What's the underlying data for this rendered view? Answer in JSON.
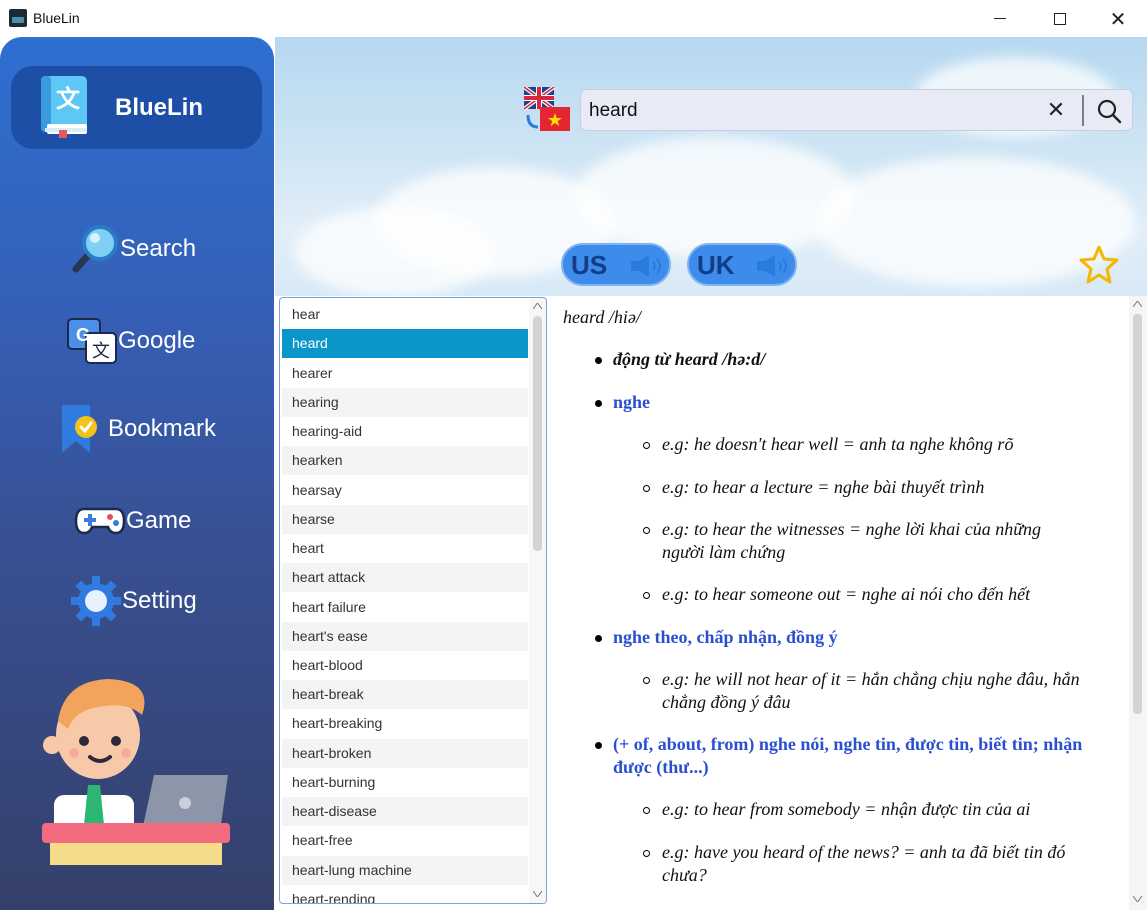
{
  "window": {
    "title": "BlueLin"
  },
  "sidebar": {
    "app_name": "BlueLin",
    "items": [
      {
        "label": "Search",
        "icon": "magnifier-icon"
      },
      {
        "label": "Google",
        "icon": "google-translate-icon"
      },
      {
        "label": "Bookmark",
        "icon": "bookmark-icon"
      },
      {
        "label": "Game",
        "icon": "gamepad-icon"
      },
      {
        "label": "Setting",
        "icon": "gear-icon"
      }
    ]
  },
  "search": {
    "value": "heard",
    "lang_pair": "en-vi"
  },
  "pronunciation": {
    "us_label": "US",
    "uk_label": "UK"
  },
  "wordlist": {
    "selected": "heard",
    "items": [
      "hear",
      "heard",
      "hearer",
      "hearing",
      "hearing-aid",
      "hearken",
      "hearsay",
      "hearse",
      "heart",
      "heart attack",
      "heart failure",
      "heart's ease",
      "heart-blood",
      "heart-break",
      "heart-breaking",
      "heart-broken",
      "heart-burning",
      "heart-disease",
      "heart-free",
      "heart-lung machine",
      "heart-rending"
    ]
  },
  "definition": {
    "headword": "heard /hiə/",
    "pos": "động từ heard /hə:d/",
    "senses": [
      {
        "meaning": "nghe",
        "examples": [
          "e.g: he doesn't hear well = anh ta nghe không rõ",
          "e.g: to hear a lecture = nghe bài thuyết trình",
          "e.g: to hear the witnesses = nghe lời khai của những",
          "người làm chứng",
          "e.g: to hear someone out = nghe ai nói cho đến hết"
        ]
      },
      {
        "meaning": "nghe theo, chấp nhận, đồng ý",
        "examples": [
          "e.g: he will not hear of it = hắn chẳng chịu nghe đâu, hắn",
          "chẳng đồng ý đâu"
        ]
      },
      {
        "meaning": "(+ of, about, from) nghe nói, nghe tin, được tin, biết tin; nhận",
        "meaning2": "được (thư...)",
        "examples": [
          "e.g: to hear from somebody = nhận được tin của ai",
          "e.g: have you heard of the news? = anh ta đã biết tin đó",
          "chưa?"
        ]
      }
    ]
  },
  "colors": {
    "sidebar_top": "#2e6fd2",
    "sidebar_bottom": "#35406a",
    "selected_row": "#0a96c8",
    "meaning_text": "#2b4fd1",
    "star": "#f5b800"
  }
}
